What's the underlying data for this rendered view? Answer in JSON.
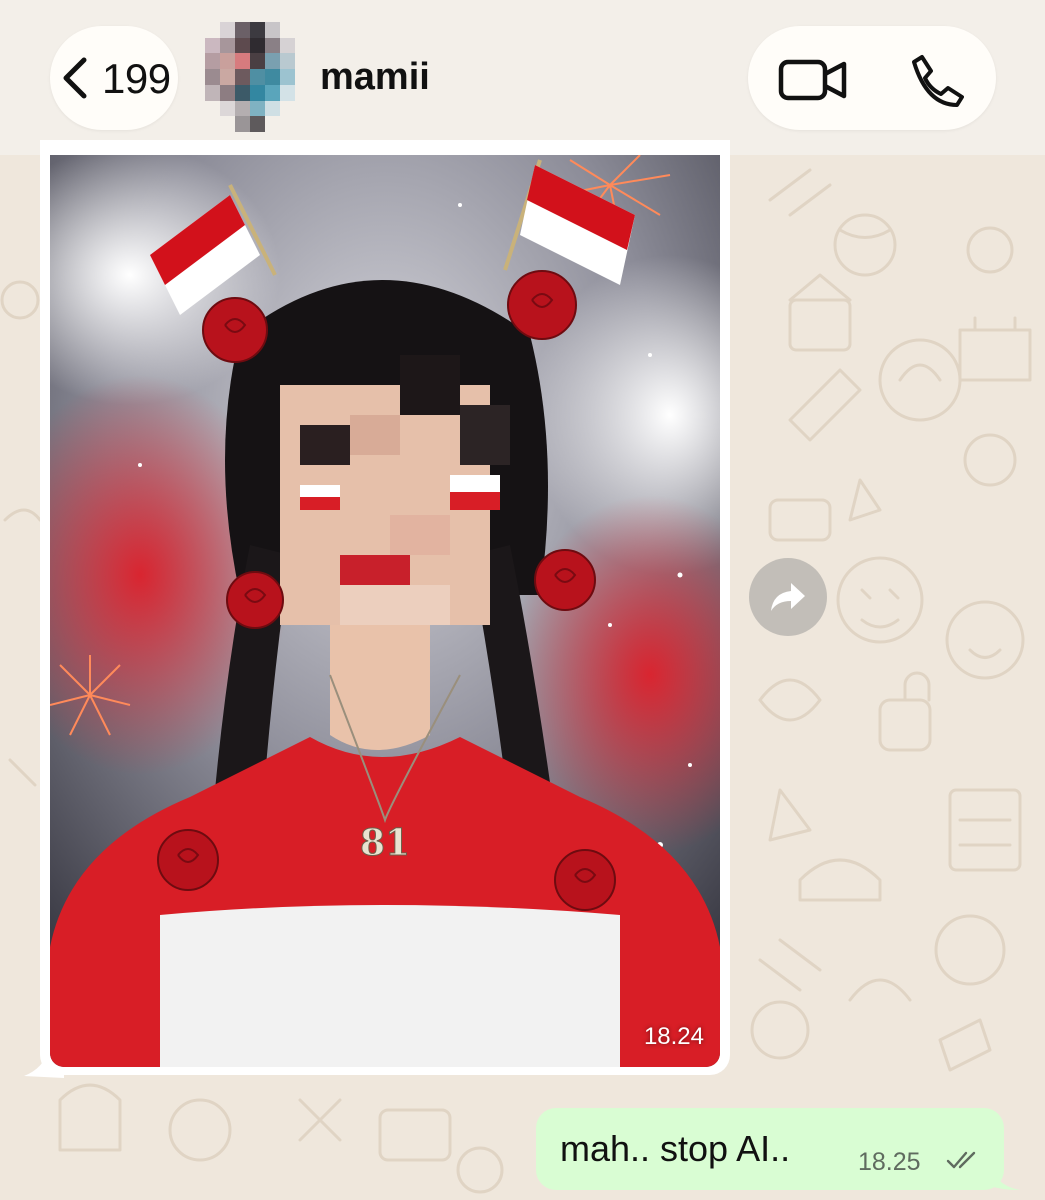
{
  "header": {
    "back_count": "199",
    "contact_name": "mamii"
  },
  "messages": {
    "incoming_image": {
      "time": "18.24",
      "pendant_text": "81"
    },
    "outgoing": {
      "text": "mah.. stop AI..",
      "time": "18.25",
      "status": "read"
    }
  },
  "icons": {
    "back": "chevron-left-icon",
    "video": "video-call-icon",
    "phone": "phone-icon",
    "forward": "forward-icon",
    "ticks": "double-check-icon"
  },
  "colors": {
    "wallpaper": "#efe7dc",
    "header": "#f3efe9",
    "outgoing_bubble": "#d9fdd3",
    "flag_red": "#d2111b"
  }
}
